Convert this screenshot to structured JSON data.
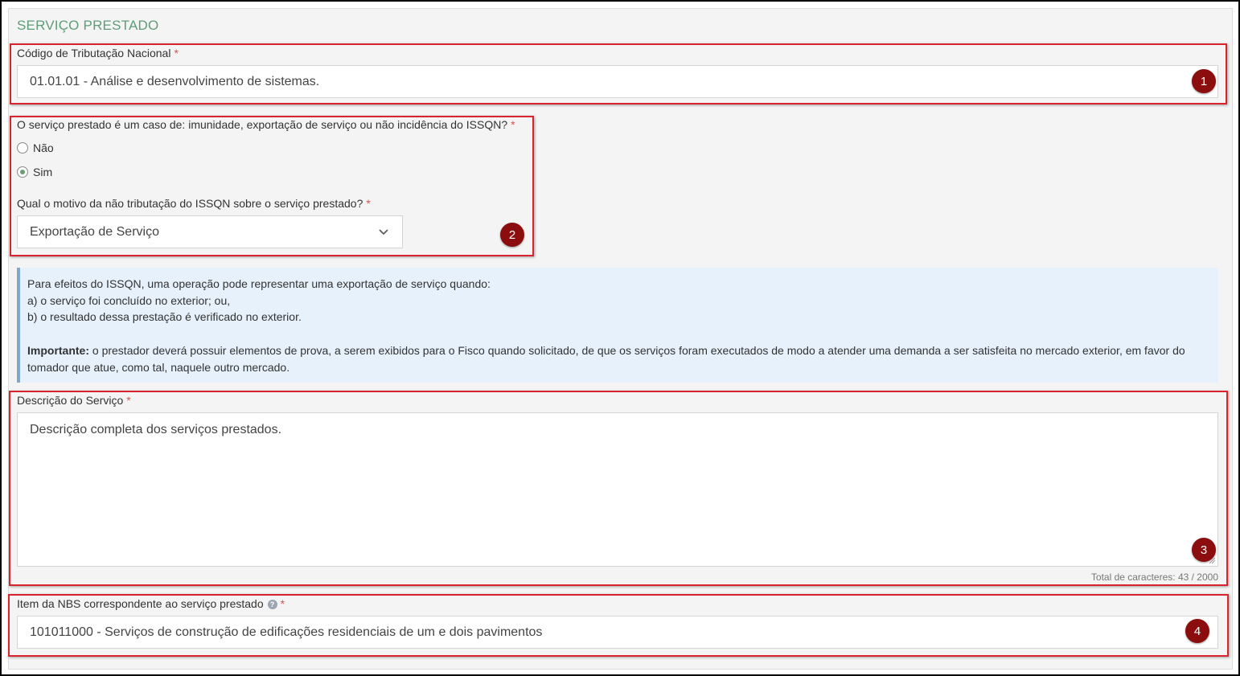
{
  "section": {
    "title": "SERVIÇO PRESTADO"
  },
  "codigo": {
    "label": "Código de Tributação Nacional",
    "required_mark": "*",
    "value": "01.01.01 - Análise e desenvolvimento de sistemas."
  },
  "imunidade": {
    "question": "O serviço prestado é um caso de: imunidade, exportação de serviço ou não incidência do ISSQN?",
    "required_mark": "*",
    "options": [
      {
        "label": "Não",
        "checked": false
      },
      {
        "label": "Sim",
        "checked": true
      }
    ]
  },
  "motivo": {
    "label": "Qual o motivo da não tributação do ISSQN sobre o serviço prestado?",
    "required_mark": "*",
    "selected": "Exportação de Serviço"
  },
  "info": {
    "lines": [
      "Para efeitos do ISSQN, uma operação pode representar uma exportação de serviço quando:",
      "a) o serviço foi concluído no exterior; ou,",
      "b) o resultado dessa prestação é verificado no exterior."
    ],
    "important_label": "Importante:",
    "important_text": " o prestador deverá possuir elementos de prova, a serem exibidos para o Fisco quando solicitado, de que os serviços foram executados de modo a atender uma demanda a ser satisfeita no mercado exterior, em favor do tomador que atue, como tal, naquele outro mercado."
  },
  "descricao": {
    "label": "Descrição do Serviço",
    "required_mark": "*",
    "value": "Descrição completa dos serviços prestados.",
    "counter": "Total de caracteres: 43 / 2000"
  },
  "nbs": {
    "label": "Item da NBS correspondente ao serviço prestado",
    "help_icon": "question-circle-icon",
    "help_glyph": "?",
    "required_mark": "*",
    "value": "101011000 - Serviços de construção de edificações residenciais de um e dois pavimentos"
  },
  "badges": [
    "1",
    "2",
    "3",
    "4"
  ],
  "colors": {
    "section_title": "#5f9c78",
    "highlight_border": "#d9232e",
    "badge_bg": "#8b0d0d",
    "info_bg": "#e6f1fb",
    "info_border": "#7fa7c9",
    "required": "#d9534f",
    "radio_checked": "#6a9e72"
  }
}
